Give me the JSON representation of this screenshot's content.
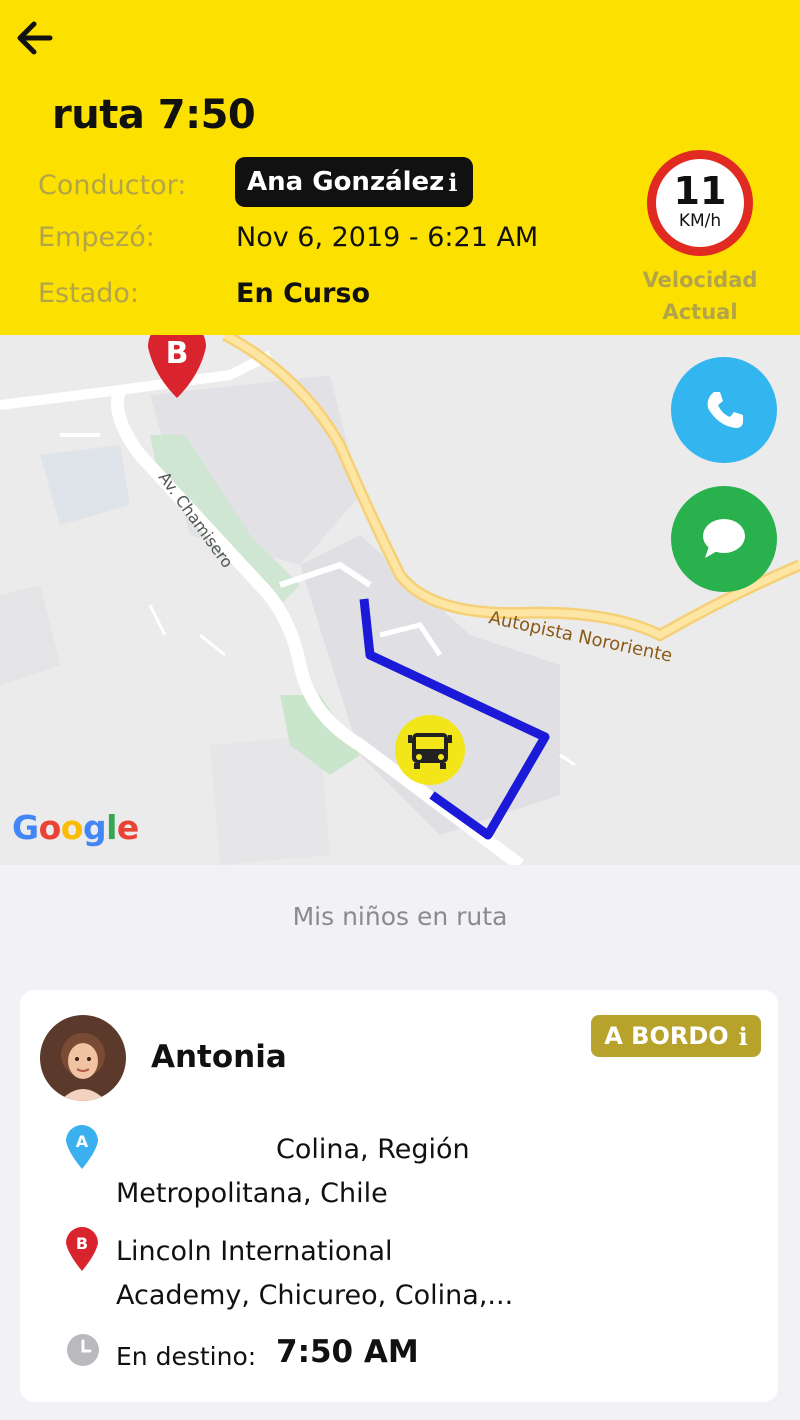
{
  "header": {
    "title": "ruta 7:50",
    "driver_label": "Conductor:",
    "driver_name": "Ana González",
    "info_glyph": "i",
    "start_label": "Empezó:",
    "start_value": "Nov 6, 2019 - 6:21 AM",
    "status_label": "Estado:",
    "status_value": "En Curso",
    "speed_value": "11",
    "speed_unit": "KM/h",
    "speed_caption_line1": "Velocidad",
    "speed_caption_line2": "Actual"
  },
  "map": {
    "road_label_1": "Av. Chamisero",
    "road_label_2": "Autopista Nororiente",
    "pin_label": "B",
    "logo_letters": [
      "G",
      "o",
      "o",
      "g",
      "l",
      "e"
    ]
  },
  "section": {
    "title": "Mis niños en ruta"
  },
  "child": {
    "name": "Antonia",
    "status_badge": "A BORDO",
    "info_glyph": "i",
    "pickup_marker": "A",
    "pickup_line1": "Colina, Región",
    "pickup_line2": "Metropolitana, Chile",
    "dropoff_marker": "B",
    "dropoff_line1": "Lincoln International",
    "dropoff_line2": "Academy, Chicureo, Colina,...",
    "arrival_label": "En destino:",
    "arrival_time": "7:50 AM"
  },
  "colors": {
    "header_bg": "#fce100",
    "label_muted": "#b3a44a",
    "speed_ring": "#e02a22",
    "call_button": "#33b5f0",
    "message_button": "#28b14c",
    "route_line": "#1a1ad8",
    "badge_bg": "#b7a32b",
    "pin_a": "#3bb0ef",
    "pin_b": "#d9232d"
  },
  "icons": {
    "back": "arrow-left-icon",
    "call": "phone-icon",
    "message": "chat-bubble-icon",
    "bus": "school-bus-icon",
    "clock": "clock-icon"
  }
}
